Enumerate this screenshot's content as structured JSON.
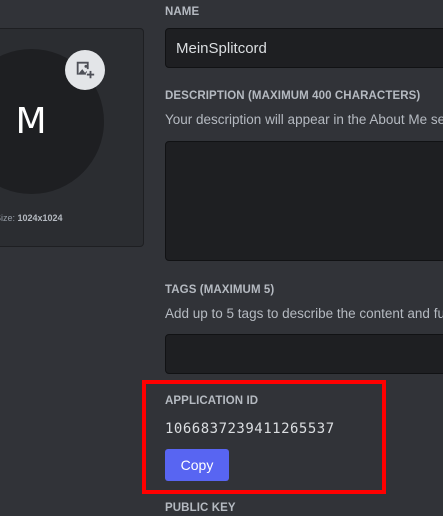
{
  "avatar": {
    "initial": "M",
    "size_prefix": "Size: ",
    "size_value": "1024x1024",
    "upload_icon": "image-add-icon"
  },
  "name": {
    "label": "NAME",
    "value": "MeinSplitcord"
  },
  "description": {
    "label": "DESCRIPTION (MAXIMUM 400 CHARACTERS)",
    "helper": "Your description will appear in the About Me se",
    "value": ""
  },
  "tags": {
    "label": "TAGS (MAXIMUM 5)",
    "helper": "Add up to 5 tags to describe the content and fu",
    "value": ""
  },
  "application_id": {
    "label": "APPLICATION ID",
    "value": "1066837239411265537",
    "copy_label": "Copy",
    "highlight_color": "#ff0000"
  },
  "public_key": {
    "label": "PUBLIC KEY"
  },
  "colors": {
    "background": "#313338",
    "input_bg": "#1e1f22",
    "accent": "#5865f2"
  }
}
